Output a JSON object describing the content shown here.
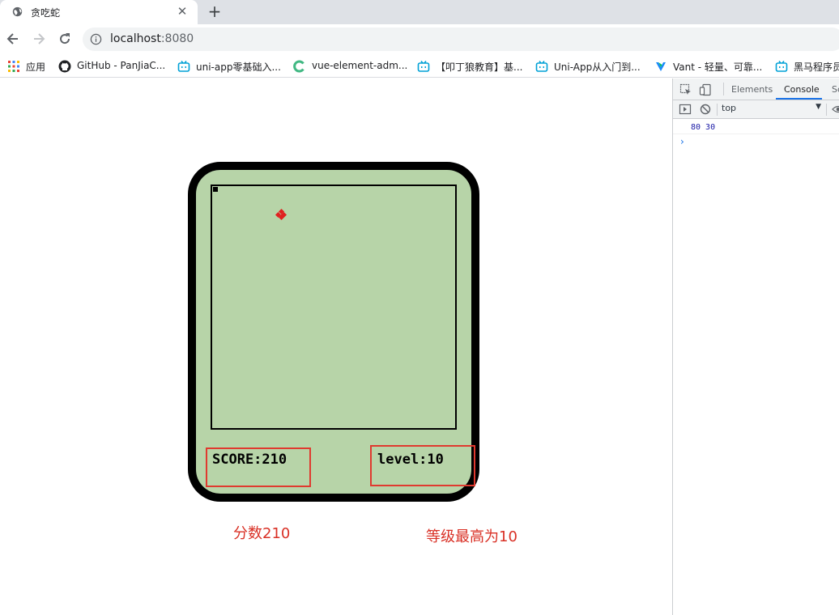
{
  "browser": {
    "tab": {
      "title": "贪吃蛇",
      "favicon": "globe-icon"
    },
    "new_tab_label": "+",
    "close_label": "✕",
    "address": {
      "host": "localhost",
      "port": ":8080"
    }
  },
  "bookmarks": [
    {
      "label": "应用",
      "icon": "apps-grid-icon"
    },
    {
      "label": "GitHub - PanJiaC...",
      "icon": "github-icon"
    },
    {
      "label": "uni-app零基础入...",
      "icon": "bilibili-icon"
    },
    {
      "label": "vue-element-adm...",
      "icon": "green-c-icon"
    },
    {
      "label": "【叩丁狼教育】基...",
      "icon": "bilibili-icon"
    },
    {
      "label": "Uni-App从入门到...",
      "icon": "bilibili-icon"
    },
    {
      "label": "Vant - 轻量、可靠...",
      "icon": "vant-icon"
    },
    {
      "label": "黑马程序员",
      "icon": "bilibili-icon"
    }
  ],
  "game": {
    "score_text": "SCORE:210",
    "level_text": "level:10",
    "annotation_score": "分数210",
    "annotation_level": "等级最高为10",
    "colors": {
      "screen": "#b7d4a8",
      "frame": "#000000",
      "food": "#e02020",
      "highlight": "#e03a2f"
    }
  },
  "devtools": {
    "tabs": [
      "Elements",
      "Console",
      "Sc"
    ],
    "active_tab": "Console",
    "context": "top",
    "log": "80 30",
    "prompt": "›"
  }
}
